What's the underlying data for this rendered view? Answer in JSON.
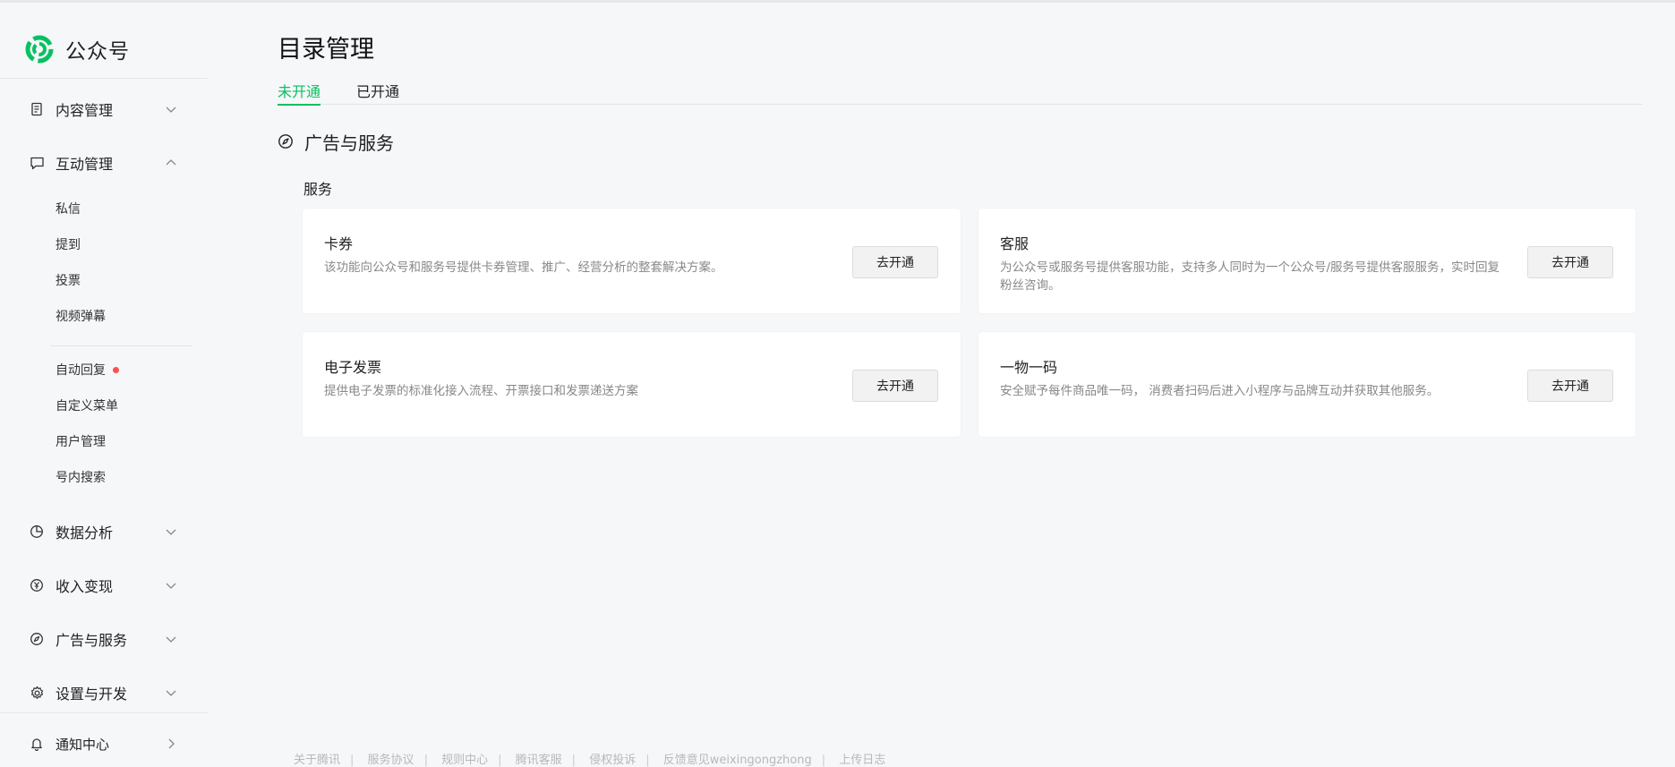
{
  "brand": {
    "name": "公众号",
    "accent": "#07c160"
  },
  "sidebar": {
    "groups": [
      {
        "label": "内容管理",
        "icon": "document-icon",
        "expanded": false
      },
      {
        "label": "互动管理",
        "icon": "chat-icon",
        "expanded": true
      },
      {
        "label": "数据分析",
        "icon": "pie-chart-icon",
        "expanded": false
      },
      {
        "label": "收入变现",
        "icon": "yen-icon",
        "expanded": false
      },
      {
        "label": "广告与服务",
        "icon": "compass-icon",
        "expanded": false
      },
      {
        "label": "设置与开发",
        "icon": "gear-icon",
        "expanded": false
      }
    ],
    "interaction_items": [
      "私信",
      "提到",
      "投票",
      "视频弹幕",
      "自动回复",
      "自定义菜单",
      "用户管理",
      "号内搜索"
    ],
    "notification": {
      "label": "通知中心",
      "icon": "bell-icon"
    }
  },
  "main": {
    "title": "目录管理",
    "tabs": [
      {
        "label": "未开通",
        "active": true
      },
      {
        "label": "已开通",
        "active": false
      }
    ],
    "section": {
      "title": "广告与服务",
      "icon": "compass-icon"
    },
    "subsection": "服务",
    "cards": [
      {
        "title": "卡券",
        "desc": "该功能向公众号和服务号提供卡券管理、推广、经营分析的整套解决方案。",
        "button": "去开通"
      },
      {
        "title": "客服",
        "desc": "为公众号或服务号提供客服功能，支持多人同时为一个公众号/服务号提供客服服务，实时回复粉丝咨询。",
        "button": "去开通"
      },
      {
        "title": "电子发票",
        "desc": "提供电子发票的标准化接入流程、开票接口和发票递送方案",
        "button": "去开通"
      },
      {
        "title": "一物一码",
        "desc": "安全赋予每件商品唯一码， 消费者扫码后进入小程序与品牌互动并获取其他服务。",
        "button": "去开通"
      }
    ]
  },
  "footer": {
    "links": [
      "关于腾讯",
      "服务协议",
      "规则中心",
      "腾讯客服",
      "侵权投诉",
      "反馈意见weixingongzhong",
      "上传日志"
    ]
  },
  "colors": {
    "background": "#f6f7f9",
    "card": "#ffffff",
    "unread_dot": "#fa5151"
  }
}
